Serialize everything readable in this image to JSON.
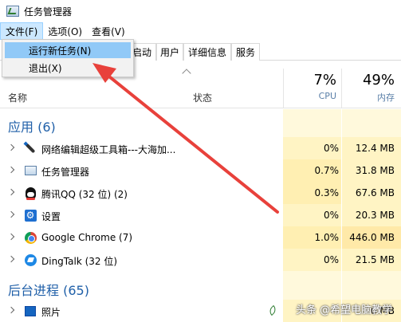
{
  "window": {
    "title": "任务管理器"
  },
  "menu": [
    {
      "label": "文件(F)"
    },
    {
      "label": "选项(O)"
    },
    {
      "label": "查看(V)"
    }
  ],
  "tabs": [
    {
      "label": "启动"
    },
    {
      "label": "用户"
    },
    {
      "label": "详细信息"
    },
    {
      "label": "服务"
    }
  ],
  "dropdown": [
    {
      "label": "运行新任务(N)"
    },
    {
      "label": "退出(X)"
    }
  ],
  "header": {
    "name": "名称",
    "status": "状态",
    "cpu_pct": "7%",
    "cpu_label": "CPU",
    "mem_pct": "49%",
    "mem_label": "内存"
  },
  "groups": {
    "apps": "应用 (6)",
    "background": "后台进程 (65)"
  },
  "apps": [
    {
      "name": "网络编辑超级工具箱---大海加...",
      "icon": "pen-icon",
      "cpu": "0%",
      "mem": "12.4 MB"
    },
    {
      "name": "任务管理器",
      "icon": "task-manager-icon",
      "cpu": "0.7%",
      "mem": "31.8 MB"
    },
    {
      "name": "腾讯QQ (32 位) (2)",
      "icon": "qq-penguin-icon",
      "cpu": "0.3%",
      "mem": "67.6 MB"
    },
    {
      "name": "设置",
      "icon": "settings-gear-icon",
      "cpu": "0%",
      "mem": "20.3 MB"
    },
    {
      "name": "Google Chrome (7)",
      "icon": "chrome-icon",
      "cpu": "1.0%",
      "mem": "446.0 MB"
    },
    {
      "name": "DingTalk (32 位)",
      "icon": "dingtalk-icon",
      "cpu": "0%",
      "mem": "21.5 MB"
    }
  ],
  "background": [
    {
      "name": "照片",
      "icon": "photos-icon",
      "cpu": "",
      "mem": "0 MB"
    }
  ],
  "watermark": "头条 @希望电脑教学",
  "colors": {
    "group": "#1f5fa8",
    "highlight": "#91c9f7",
    "arrow": "#e8413b",
    "heat": "#fff4c4"
  }
}
